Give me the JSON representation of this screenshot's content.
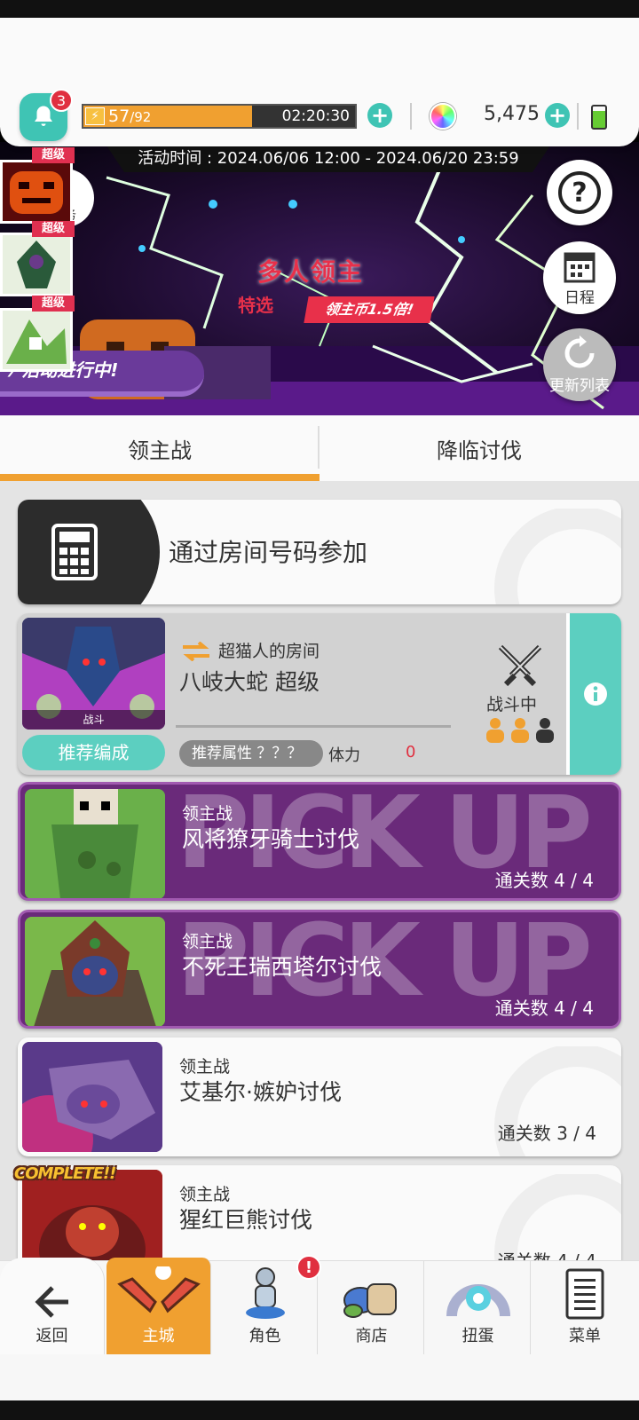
{
  "header": {
    "notification_count": "3",
    "stamina_current": "57",
    "stamina_max": "/92",
    "stamina_fraction": 0.62,
    "stamina_timer": "02:20:30",
    "gem_count": "5,475"
  },
  "banner": {
    "event_time": "活动时间 : 2024.06/06 12:00 - 2024.06/20 23:59",
    "title": "多人领主",
    "subtitle": "特选",
    "tag": "领主币1.5倍!",
    "active_label": "活动进行中!",
    "super_tags": [
      "超级",
      "超级",
      "超级"
    ],
    "task_label": "任务",
    "schedule_label": "日程",
    "refresh_label": "更新列表"
  },
  "tabs": [
    {
      "label": "领主战",
      "active": true
    },
    {
      "label": "降临讨伐",
      "active": false
    }
  ],
  "room_code": {
    "label": "通过房间号码参加"
  },
  "room": {
    "owner": "超猫人的房间",
    "boss": "八岐大蛇 超级",
    "thumb_label": "战斗",
    "recommend_label": "推荐编成",
    "attribute_label": "推荐属性 ？？？",
    "stamina_label": "体力",
    "stamina_value": "0",
    "status": "战斗中",
    "players_joined": 2,
    "players_max": 3
  },
  "bosses": [
    {
      "category": "领主战",
      "name": "风将獠牙骑士讨伐",
      "clear": "通关数 4 / 4",
      "pickup": true,
      "watermark": "PICK UP"
    },
    {
      "category": "领主战",
      "name": "不死王瑞西塔尔讨伐",
      "clear": "通关数 4 / 4",
      "pickup": true,
      "watermark": "PICK UP"
    },
    {
      "category": "领主战",
      "name": "艾基尔·嫉妒讨伐",
      "clear": "通关数 3 / 4",
      "pickup": false
    },
    {
      "category": "领主战",
      "name": "猩红巨熊讨伐",
      "clear": "通关数 4 / 4",
      "pickup": false,
      "badge": "COMPLETE!!"
    }
  ],
  "nav": [
    {
      "label": "返回",
      "icon": "arrow-left-icon"
    },
    {
      "label": "主城",
      "icon": "castle-icon",
      "active": true
    },
    {
      "label": "角色",
      "icon": "character-icon",
      "badge": "!"
    },
    {
      "label": "商店",
      "icon": "shop-icon"
    },
    {
      "label": "扭蛋",
      "icon": "gacha-icon"
    },
    {
      "label": "菜单",
      "icon": "menu-icon"
    }
  ],
  "colors": {
    "accent_orange": "#f0a030",
    "teal": "#3fc4b4",
    "pickup_purple": "#6a2a7a",
    "badge_red": "#e03040"
  }
}
